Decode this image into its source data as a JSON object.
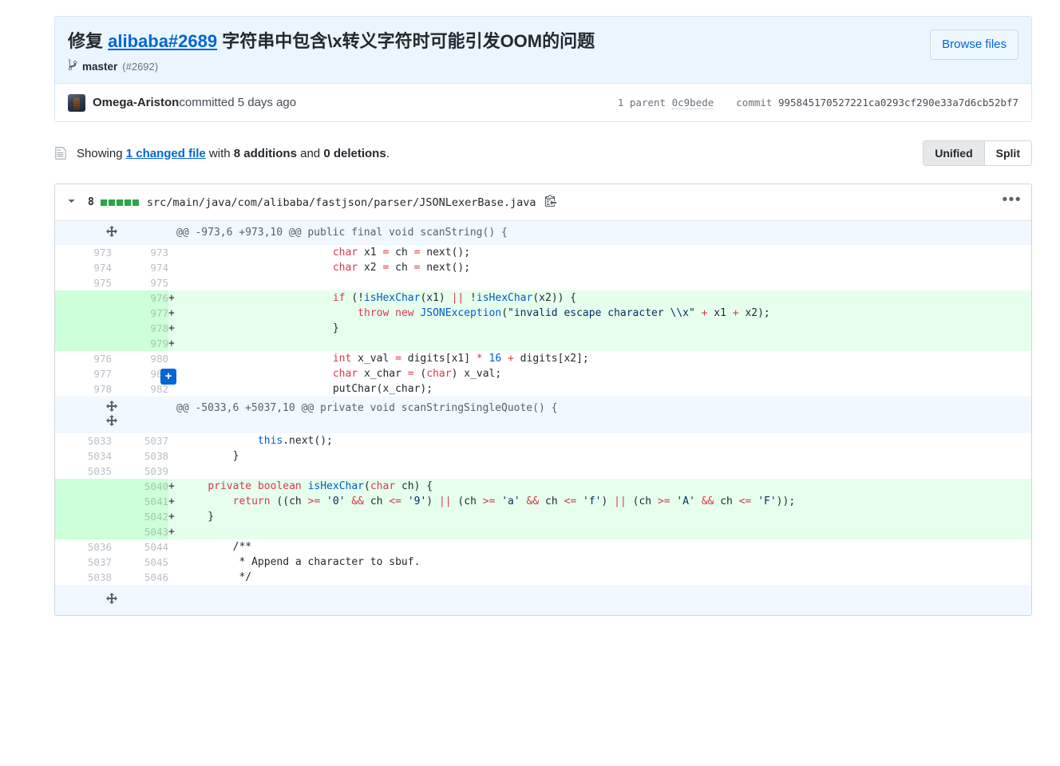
{
  "commit": {
    "title_prefix": "修复 ",
    "title_link": "alibaba#2689",
    "title_suffix": " 字符串中包含\\x转义字符时可能引发OOM的问题",
    "branch": "master",
    "pr_number": "(#2692)",
    "browse_files_label": "Browse files",
    "author": "Omega-Ariston",
    "committed_text": " committed 5 days ago",
    "parent_label": "1 parent",
    "parent_sha": "0c9bede",
    "commit_label": "commit",
    "commit_sha": "995845170527221ca0293cf290e33a7d6cb52bf7"
  },
  "summary": {
    "showing": "Showing ",
    "changed_file": "1 changed file",
    "with": " with ",
    "additions": "8 additions",
    "and": " and ",
    "deletions": "0 deletions",
    "period": ".",
    "unified_label": "Unified",
    "split_label": "Split"
  },
  "file": {
    "additions_count": "8",
    "path": "src/main/java/com/alibaba/fastjson/parser/JSONLexerBase.java",
    "squares": 5,
    "kebab": "•••"
  },
  "hunks": [
    {
      "header": "@@ -973,6 +973,10 @@ public final void scanString() {",
      "expander": "unfold-icon",
      "rows": [
        {
          "type": "ctx",
          "old": "973",
          "new": "973",
          "marker": "",
          "code": "                        char x1 = ch = next();"
        },
        {
          "type": "ctx",
          "old": "974",
          "new": "974",
          "marker": "",
          "code": "                        char x2 = ch = next();"
        },
        {
          "type": "ctx",
          "old": "975",
          "new": "975",
          "marker": "",
          "code": ""
        },
        {
          "type": "add",
          "old": "",
          "new": "976",
          "marker": "+",
          "code": "                        if (!isHexChar(x1) || !isHexChar(x2)) {"
        },
        {
          "type": "add",
          "old": "",
          "new": "977",
          "marker": "+",
          "code": "                            throw new JSONException(\"invalid escape character \\\\x\" + x1 + x2);"
        },
        {
          "type": "add",
          "old": "",
          "new": "978",
          "marker": "+",
          "code": "                        }"
        },
        {
          "type": "add",
          "old": "",
          "new": "979",
          "marker": "+",
          "code": ""
        },
        {
          "type": "ctx",
          "old": "976",
          "new": "980",
          "marker": "",
          "code": "                        int x_val = digits[x1] * 16 + digits[x2];"
        },
        {
          "type": "ctx",
          "old": "977",
          "new": "981",
          "marker": "",
          "code": "                        char x_char = (char) x_val;",
          "add_comment": "+"
        },
        {
          "type": "ctx",
          "old": "978",
          "new": "982",
          "marker": "",
          "code": "                        putChar(x_char);"
        }
      ]
    },
    {
      "header": "@@ -5033,6 +5037,10 @@ private void scanStringSingleQuote() {",
      "expander": "unfold-both-icon",
      "rows": [
        {
          "type": "ctx",
          "old": "5033",
          "new": "5037",
          "marker": "",
          "code": "            this.next();"
        },
        {
          "type": "ctx",
          "old": "5034",
          "new": "5038",
          "marker": "",
          "code": "        }"
        },
        {
          "type": "ctx",
          "old": "5035",
          "new": "5039",
          "marker": "",
          "code": ""
        },
        {
          "type": "add",
          "old": "",
          "new": "5040",
          "marker": "+",
          "code": "    private boolean isHexChar(char ch) {"
        },
        {
          "type": "add",
          "old": "",
          "new": "5041",
          "marker": "+",
          "code": "        return ((ch >= '0' && ch <= '9') || (ch >= 'a' && ch <= 'f') || (ch >= 'A' && ch <= 'F'));"
        },
        {
          "type": "add",
          "old": "",
          "new": "5042",
          "marker": "+",
          "code": "    }"
        },
        {
          "type": "add",
          "old": "",
          "new": "5043",
          "marker": "+",
          "code": ""
        },
        {
          "type": "ctx",
          "old": "5036",
          "new": "5044",
          "marker": "",
          "code": "        /**"
        },
        {
          "type": "ctx",
          "old": "5037",
          "new": "5045",
          "marker": "",
          "code": "         * Append a character to sbuf."
        },
        {
          "type": "ctx",
          "old": "5038",
          "new": "5046",
          "marker": "",
          "code": "         */"
        }
      ]
    }
  ],
  "tail": {
    "expander": "unfold-down-icon"
  },
  "colors": {
    "link": "#0366d6",
    "add_bg": "#e6ffed",
    "add_gutter": "#cdffd8",
    "hunk_bg": "#f1f8ff",
    "header_bg": "#eaf5fd",
    "green_square": "#28a745",
    "keyword": "#d73a49",
    "string": "#032f62"
  }
}
